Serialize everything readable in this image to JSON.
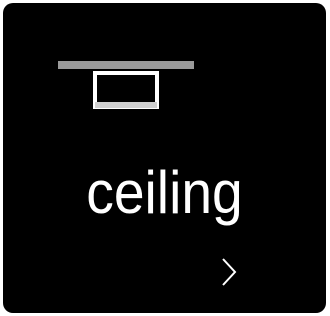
{
  "tile": {
    "label": "ceiling",
    "icon": "ceiling-light-icon",
    "action_icon": "chevron-right-icon"
  },
  "colors": {
    "background": "#000000",
    "text": "#ffffff",
    "icon_bar": "#9a9a9a",
    "icon_outline": "#ffffff"
  }
}
